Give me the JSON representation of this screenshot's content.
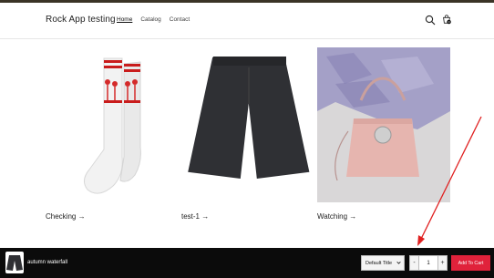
{
  "header": {
    "logo": "Rock App testing",
    "nav": [
      "Home",
      "Catalog",
      "Contact"
    ],
    "cart_count": "0"
  },
  "products": [
    {
      "title": "Checking"
    },
    {
      "title": "test-1"
    },
    {
      "title": "Watching"
    }
  ],
  "arrow_glyph": "→",
  "sticky_bar": {
    "product_title": "autumn waterfall",
    "variant": "Default Title",
    "quantity": "1",
    "minus": "-",
    "plus": "+",
    "add_to_cart": "Add To Cart"
  },
  "colors": {
    "accent_red": "#e0223b",
    "sticky_bg": "#0b0b0b",
    "annotation_arrow": "#e02020"
  },
  "icons": [
    "search-icon",
    "cart-icon",
    "chevron-down-icon"
  ]
}
